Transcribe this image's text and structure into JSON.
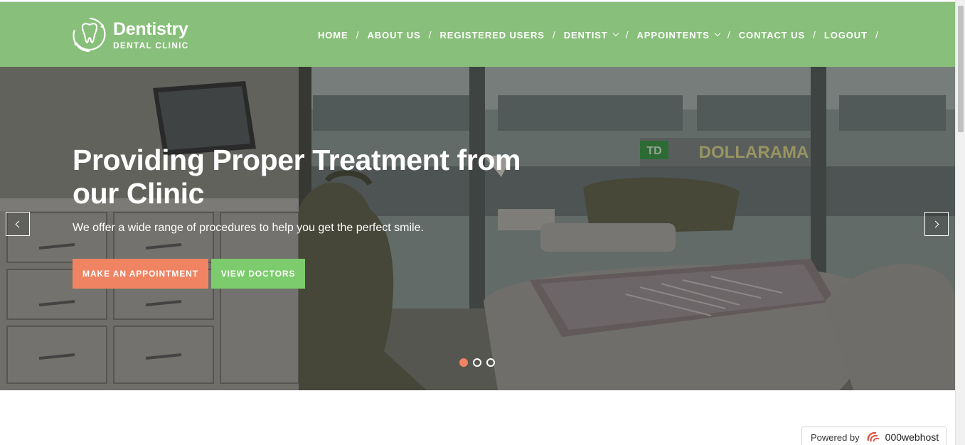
{
  "brand": {
    "title": "Dentistry",
    "subtitle": "DENTAL CLINIC",
    "header_color": "#88bf7a"
  },
  "nav": {
    "items": [
      {
        "label": "HOME",
        "dropdown": false
      },
      {
        "label": "ABOUT US",
        "dropdown": false
      },
      {
        "label": "REGISTERED USERS",
        "dropdown": false
      },
      {
        "label": "DENTIST",
        "dropdown": true
      },
      {
        "label": "APPOINTENTS",
        "dropdown": true
      },
      {
        "label": "CONTACT US",
        "dropdown": false
      },
      {
        "label": "LOGOUT",
        "dropdown": false
      }
    ],
    "separator": "/"
  },
  "hero": {
    "title": "Providing Proper Treatment from our Clinic",
    "subtitle": "We offer a wide range of procedures to help you get the perfect smile.",
    "buttons": {
      "appointment": "MAKE AN APPOINTMENT",
      "doctors": "VIEW DOCTORS"
    },
    "colors": {
      "appointment": "#f08462",
      "doctors": "#7ccb6c"
    },
    "slides_total": 3,
    "active_slide": 1,
    "sign_text": "DOLLARAMA",
    "sign_logo": "TD"
  },
  "footer_badge": {
    "powered_by": "Powered by",
    "host": "000webhost"
  }
}
